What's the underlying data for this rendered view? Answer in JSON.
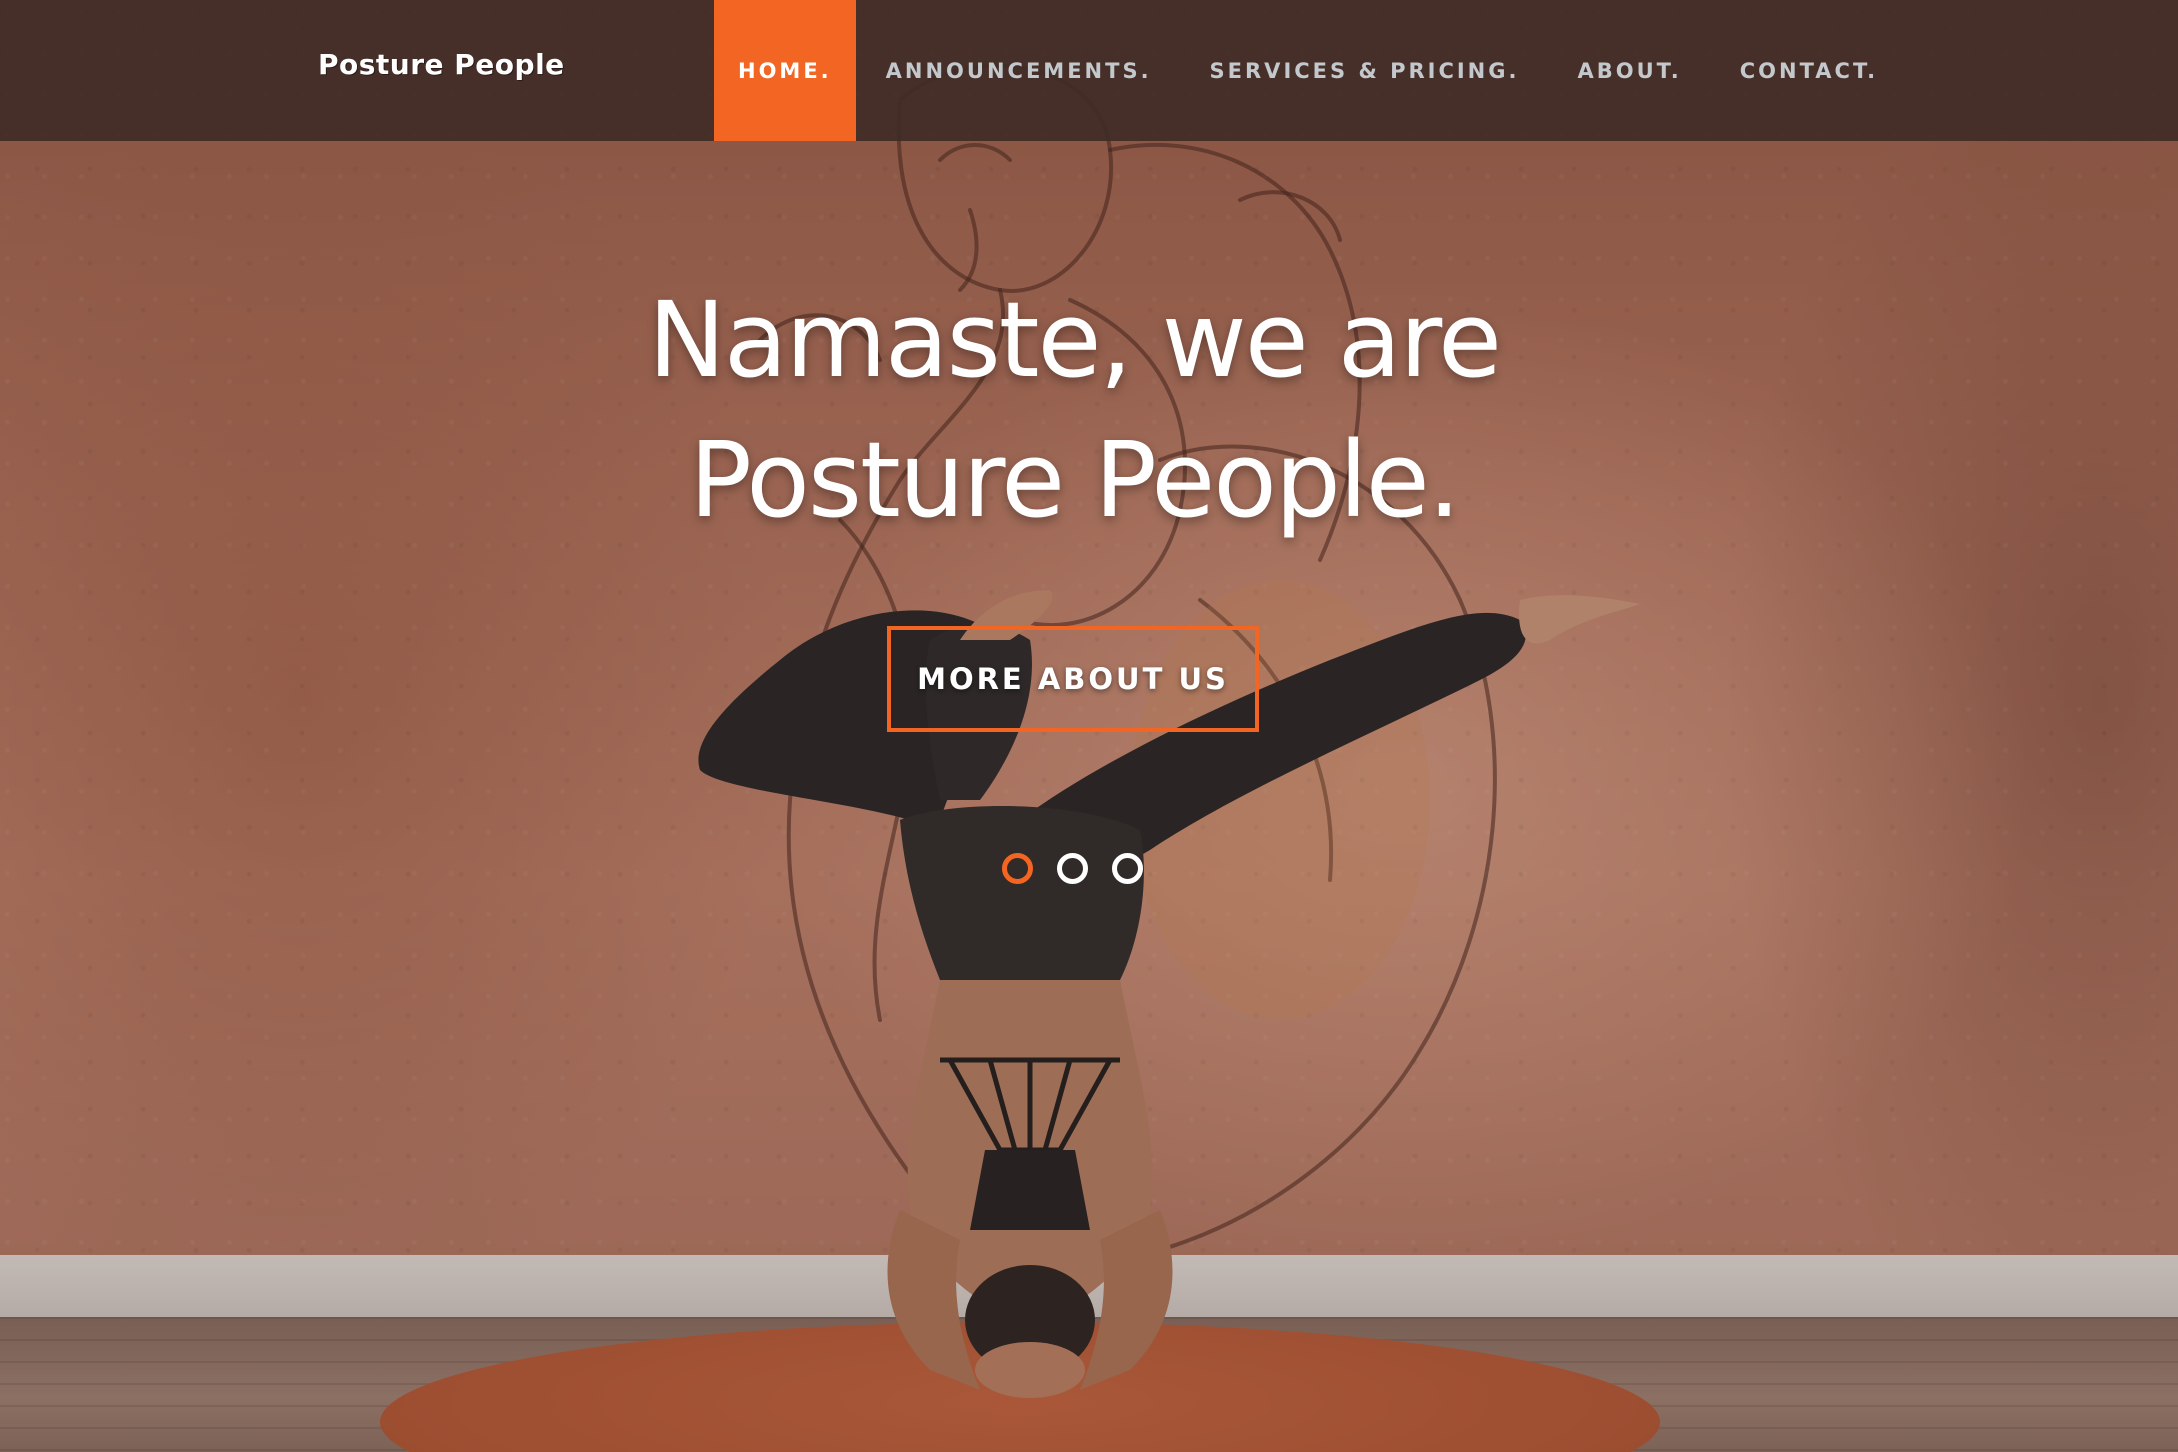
{
  "brand": {
    "name": "Posture People"
  },
  "nav": {
    "items": [
      {
        "label": "HOME.",
        "active": true
      },
      {
        "label": "ANNOUNCEMENTS.",
        "active": false
      },
      {
        "label": "SERVICES & PRICING.",
        "active": false
      },
      {
        "label": "ABOUT.",
        "active": false
      },
      {
        "label": "CONTACT.",
        "active": false
      }
    ]
  },
  "hero": {
    "title_line1": "Namaste, we are",
    "title_line2": "Posture People.",
    "cta_label": "MORE ABOUT US",
    "slides": {
      "count": 3,
      "active_index": 0
    }
  },
  "colors": {
    "accent": "#f26522",
    "navbar_bg": "#3e2a26",
    "nav_text": "#c3c8cc",
    "hero_text": "#ffffff"
  }
}
